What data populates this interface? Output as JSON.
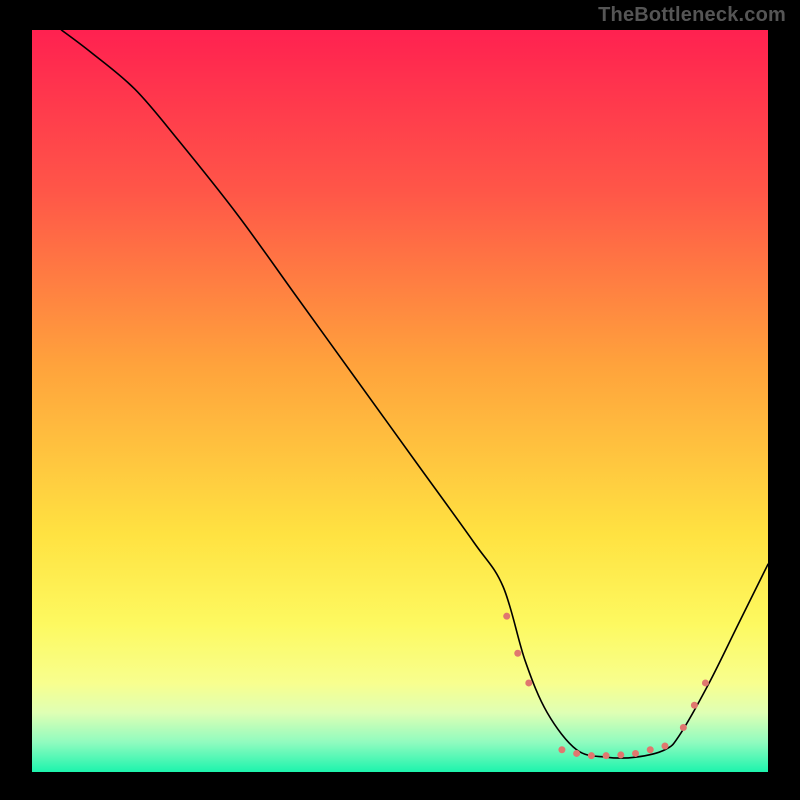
{
  "watermark": "TheBottleneck.com",
  "chart_data": {
    "type": "line",
    "title": "",
    "xlabel": "",
    "ylabel": "",
    "xlim": [
      0,
      100
    ],
    "ylim": [
      0,
      100
    ],
    "grid": false,
    "background_gradient": {
      "stops": [
        {
          "offset": 0.0,
          "color": "#ff2150"
        },
        {
          "offset": 0.22,
          "color": "#ff5748"
        },
        {
          "offset": 0.45,
          "color": "#ffa23c"
        },
        {
          "offset": 0.68,
          "color": "#ffe241"
        },
        {
          "offset": 0.8,
          "color": "#fdf960"
        },
        {
          "offset": 0.88,
          "color": "#f8ff8e"
        },
        {
          "offset": 0.92,
          "color": "#dfffb4"
        },
        {
          "offset": 0.96,
          "color": "#90fbbf"
        },
        {
          "offset": 1.0,
          "color": "#1df4ad"
        }
      ]
    },
    "series": [
      {
        "name": "bottleneck_curve",
        "color": "#000000",
        "x": [
          4,
          8,
          14,
          20,
          28,
          36,
          44,
          52,
          60,
          64,
          67,
          70,
          74,
          78,
          82,
          86,
          88,
          92,
          96,
          100
        ],
        "y": [
          100,
          97,
          92,
          85,
          75,
          64,
          53,
          42,
          31,
          25,
          15,
          8,
          3,
          2,
          2,
          3,
          5,
          12,
          20,
          28
        ]
      }
    ],
    "markers": {
      "name": "highlight_zone",
      "color": "#e0776f",
      "radius": 3.5,
      "points": [
        {
          "x": 64.5,
          "y": 21
        },
        {
          "x": 66,
          "y": 16
        },
        {
          "x": 67.5,
          "y": 12
        },
        {
          "x": 72,
          "y": 3
        },
        {
          "x": 74,
          "y": 2.5
        },
        {
          "x": 76,
          "y": 2.2
        },
        {
          "x": 78,
          "y": 2.2
        },
        {
          "x": 80,
          "y": 2.3
        },
        {
          "x": 82,
          "y": 2.5
        },
        {
          "x": 84,
          "y": 3
        },
        {
          "x": 86,
          "y": 3.5
        },
        {
          "x": 88.5,
          "y": 6
        },
        {
          "x": 90,
          "y": 9
        },
        {
          "x": 91.5,
          "y": 12
        }
      ]
    }
  }
}
